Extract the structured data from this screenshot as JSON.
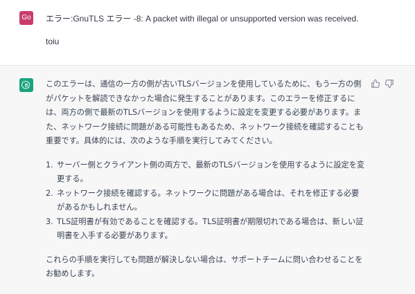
{
  "user_message": {
    "avatar_text": "Go",
    "line1": "エラー:GnuTLS エラー -8: A packet with illegal or unsupported version was received.",
    "line2": "toiu"
  },
  "assistant_message": {
    "paragraph1": "このエラーは、通信の一方の側が古いTLSバージョンを使用しているために、もう一方の側がパケットを解読できなかった場合に発生することがあります。このエラーを修正するには、両方の側で最新のTLSバージョンを使用するように設定を変更する必要があります。また、ネットワーク接続に問題がある可能性もあるため、ネットワーク接続を確認することも重要です。具体的には、次のような手順を実行してみてください。",
    "steps": [
      {
        "num": "1.",
        "text": "サーバー側とクライアント側の両方で、最新のTLSバージョンを使用するように設定を変更する。"
      },
      {
        "num": "2.",
        "text": "ネットワーク接続を確認する。ネットワークに問題がある場合は、それを修正する必要があるかもしれません。"
      },
      {
        "num": "3.",
        "text": "TLS証明書が有効であることを確認する。TLS証明書が期限切れである場合は、新しい証明書を入手する必要があります。"
      }
    ],
    "paragraph2": "これらの手順を実行しても問題が解決しない場合は、サポートチームに問い合わせることをお勧めします。"
  },
  "icons": {
    "assistant_avatar": "openai-logo-icon",
    "thumbs_up": "thumbs-up-icon",
    "thumbs_down": "thumbs-down-icon"
  },
  "colors": {
    "user_avatar": "#c93c6b",
    "assistant_avatar": "#19a37f",
    "assistant_background": "#f7f7f8"
  }
}
